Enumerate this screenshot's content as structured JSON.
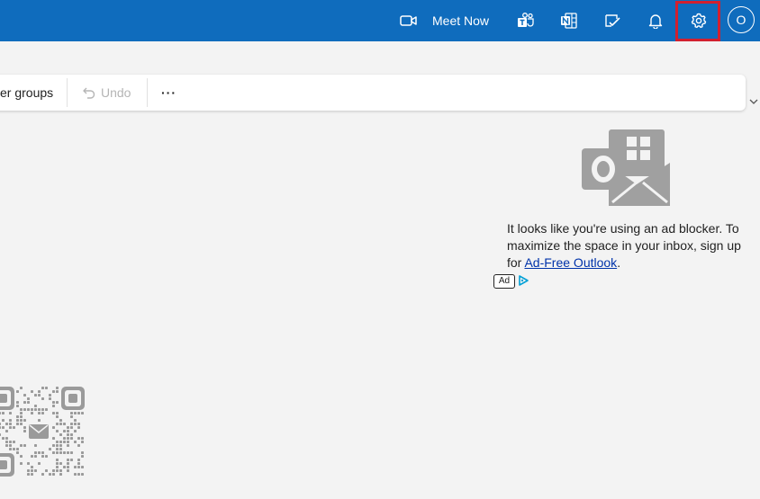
{
  "topbar": {
    "meet_now_label": "Meet Now",
    "icons": [
      "video-camera-icon",
      "teams-icon",
      "onenote-icon",
      "to-do-icon",
      "bell-icon",
      "gear-icon"
    ],
    "avatar_initial": "O",
    "accent": "#0f6cbd",
    "highlight_color": "#d1202f"
  },
  "commandbar": {
    "groups_label": "er groups",
    "undo_label": "Undo",
    "more_label": "···"
  },
  "ad": {
    "text_before": "It looks like you're using an ad blocker. To maximize the space in your inbox, sign up for ",
    "link_text": "Ad-Free Outlook",
    "text_after": ".",
    "badge": "Ad"
  }
}
